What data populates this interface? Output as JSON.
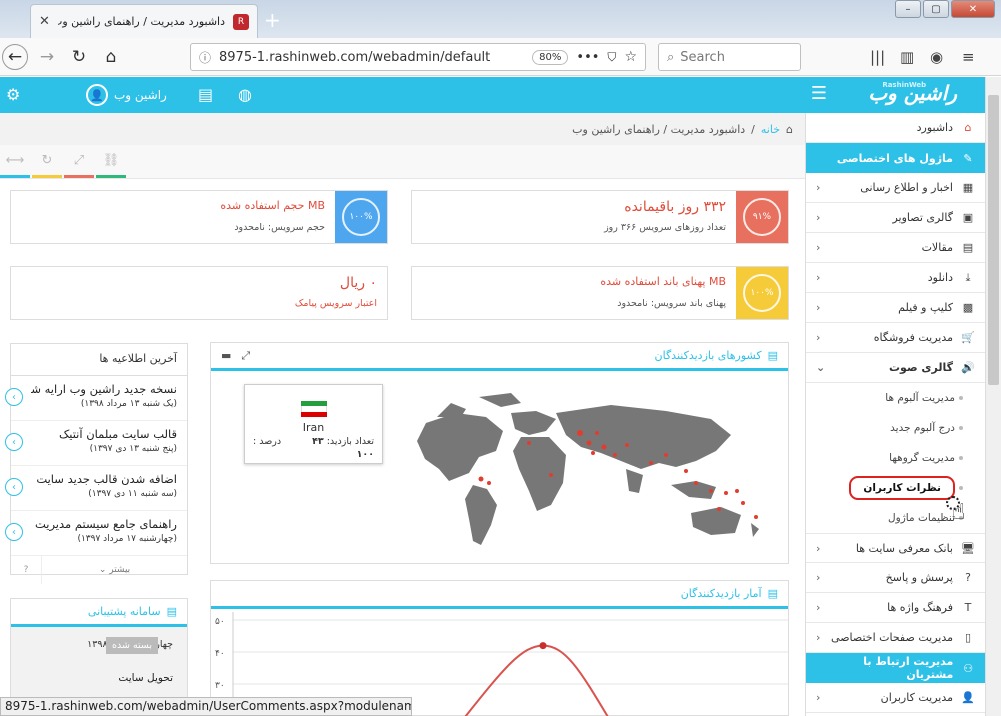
{
  "browser": {
    "tab_title": "داشبورد مدیریت / راهنمای راشین وب",
    "url": "8975-1.rashinweb.com/webadmin/default",
    "zoom": "80%",
    "search_placeholder": "Search",
    "status_url": "8975-1.rashinweb.com/webadmin/UserComments.aspx?modulename=sound"
  },
  "header": {
    "logo": "راشین وب",
    "logo_small": "RashinWeb",
    "user_name": "راشین وب"
  },
  "breadcrumb": {
    "home": "خانه",
    "separator": "/",
    "current": "داشبورد مدیریت / راهنمای راشین وب"
  },
  "stats": {
    "days": {
      "value": "۳۳۲ روز باقیمانده",
      "sub": "تعداد روزهای سرویس ۳۶۶ روز",
      "pct": "۹۱%",
      "pct_value": 91,
      "color": "#e8705f"
    },
    "disk": {
      "value": "MB حجم استفاده شده",
      "sub": "حجم سرویس: نامحدود",
      "pct": "۱۰۰%",
      "pct_value": 100,
      "color": "#4ea6ef"
    },
    "bandwidth": {
      "value": "MB پهنای باند استفاده شده",
      "sub": "پهنای باند سرویس: نامحدود",
      "pct": "۱۰۰%",
      "pct_value": 100,
      "color": "#f5cb3a"
    },
    "sms": {
      "value": "۰ ریال",
      "sub": "اعتبار سرویس پیامک"
    }
  },
  "news": {
    "title": "آخرین اطلاعیه ها",
    "items": [
      {
        "title": "نسخه جدید راشین وب ارایه شد.",
        "date": "(یک شنبه ۱۳ مرداد ۱۳۹۸)"
      },
      {
        "title": "قالب سایت مبلمان آنتیک",
        "date": "(پنج شنبه ۱۳ دی ۱۳۹۷)"
      },
      {
        "title": "اضافه شدن قالب جدید سایت",
        "date": "(سه شنبه ۱۱ دی ۱۳۹۷)"
      },
      {
        "title": "راهنمای جامع سیستم مدیریت",
        "date": "(چهارشنبه ۱۷ مرداد ۱۳۹۷)"
      }
    ],
    "more": "بیشتر",
    "help": "?"
  },
  "support": {
    "title": "سامانه پشتیبانی",
    "date": "چهارشنبه ۳ مهر ۱۳۹۸",
    "badge": "بسته شده",
    "item": "تحویل سایت"
  },
  "map_panel": {
    "title": "کشورهای بازدیدکنندگان",
    "country": "Iran",
    "visits_label": "تعداد بازدید:",
    "visits": "۴۳",
    "percent_label": "درصد :",
    "percent": "۱۰۰"
  },
  "chart_panel": {
    "title": "آمار بازدیدکنندگان"
  },
  "chart_data": {
    "type": "line",
    "title": "",
    "y_ticks": [
      "۵۰",
      "۴۰",
      "۳۰"
    ],
    "ylim": [
      0,
      50
    ],
    "peak": 42
  },
  "sidebar": {
    "dashboard": "داشبورد",
    "custom_modules": "ماژول های اختصاصی",
    "items": [
      {
        "label": "اخبار و اطلاع رسانی"
      },
      {
        "label": "گالری تصاویر"
      },
      {
        "label": "مقالات"
      },
      {
        "label": "دانلود"
      },
      {
        "label": "کلیپ و فیلم"
      },
      {
        "label": "مدیریت فروشگاه"
      }
    ],
    "sound_gallery": "گالری صوت",
    "sound_sub": [
      "مدیریت آلبوم ها",
      "درج آلبوم جدید",
      "مدیریت گروهها",
      "نظرات کاربران",
      "تنظیمات ماژول"
    ],
    "more_items": [
      {
        "label": "بانک معرفی سایت ها"
      },
      {
        "label": "پرسش و پاسخ"
      },
      {
        "label": "فرهنگ واژه ها"
      },
      {
        "label": "مدیریت صفحات اختصاصی"
      }
    ],
    "customer_comm": "مدیریت ارتباط با مشتریان",
    "users": "مدیریت کاربران"
  },
  "colors": {
    "accent": "#2ec1e8",
    "red": "#e04b3a"
  }
}
